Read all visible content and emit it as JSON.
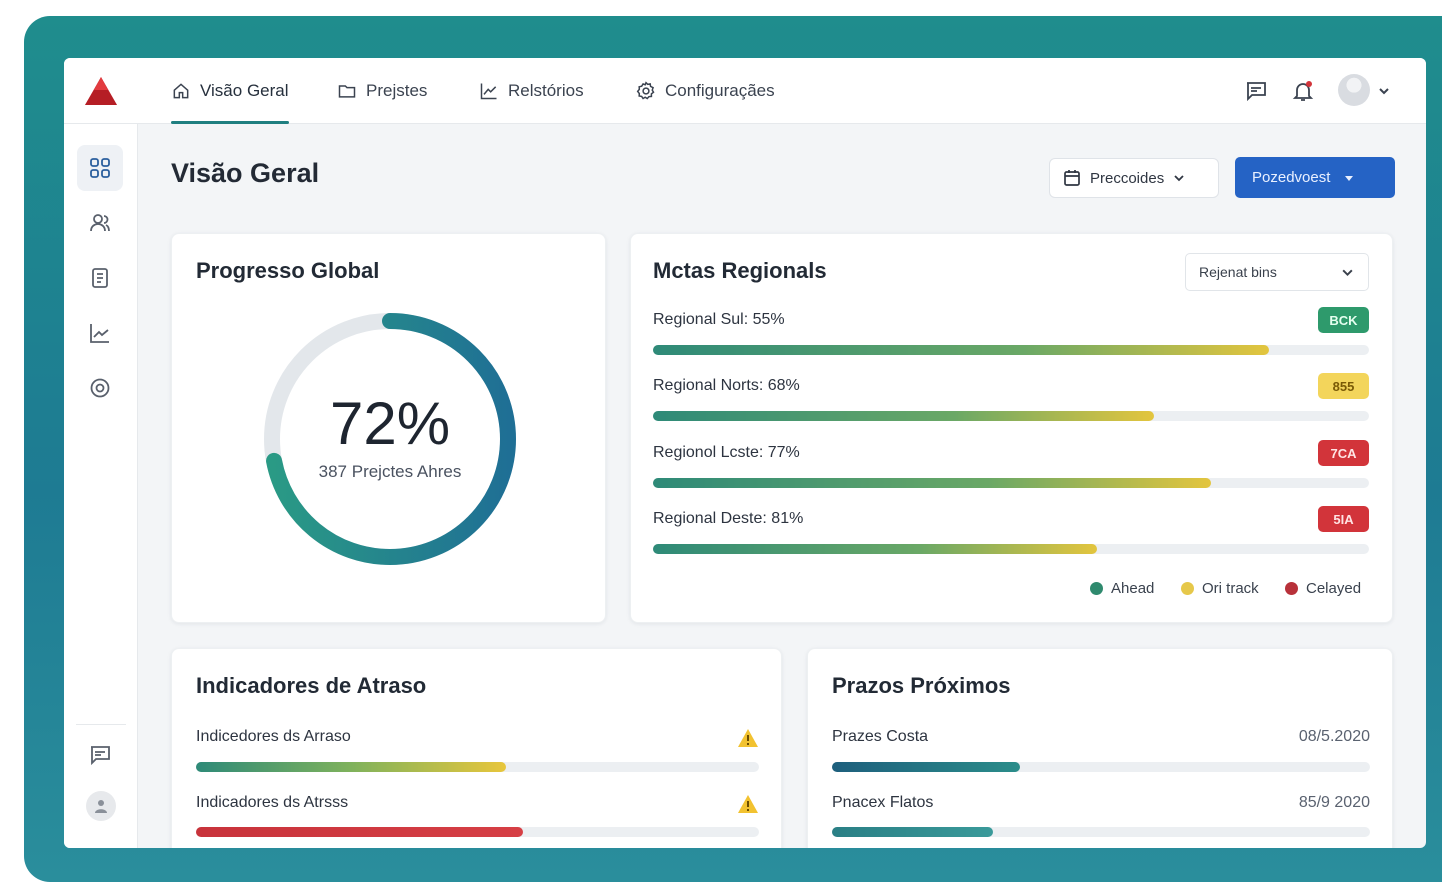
{
  "nav": {
    "tabs": [
      {
        "label": "Visão Geral",
        "icon": "home-icon",
        "active": true
      },
      {
        "label": "Prejstes",
        "icon": "folder-icon"
      },
      {
        "label": "Relstórios",
        "icon": "chart-icon"
      },
      {
        "label": "Configuraçães",
        "icon": "settings-gear-icon"
      }
    ]
  },
  "header": {
    "title": "Visão Geral",
    "period_button": "Preccoides",
    "primary_button": "Pozedvoest"
  },
  "progress_card": {
    "title": "Progresso Global",
    "value_label": "72%",
    "progress": 0.72,
    "subtitle": "387 Prejctes Ahres"
  },
  "regional_card": {
    "title": "Mctas Regionals",
    "select_value": "Rejenat bins",
    "rows": [
      {
        "label": "Regional Sul: 55%",
        "progress": 0.86,
        "badge": "BCK",
        "badge_color": "#2e9a6c",
        "badge_text_color": "#e6fff0"
      },
      {
        "label": "Regional Norts: 68%",
        "progress": 0.7,
        "badge": "855",
        "badge_color": "#f3d55b",
        "badge_text_color": "#7a5a06"
      },
      {
        "label": "Regionol Lcste: 77%",
        "progress": 0.78,
        "badge": "7CA",
        "badge_color": "#d2343a",
        "badge_text_color": "#ffe4e4"
      },
      {
        "label": "Regional Deste: 81%",
        "progress": 0.62,
        "badge": "5IA",
        "badge_color": "#d2343a",
        "badge_text_color": "#ffe4e4"
      }
    ],
    "legend": [
      {
        "label": "Ahead",
        "color": "#2f8a6e"
      },
      {
        "label": "Ori track",
        "color": "#e6c84a"
      },
      {
        "label": "Celayed",
        "color": "#b8313a"
      }
    ]
  },
  "delay_card": {
    "title": "Indicadores de Atraso",
    "rows": [
      {
        "label": "Indicedores ds Arraso",
        "progress": 0.55
      },
      {
        "label": "Indicadores ds Atrsss",
        "progress": 0.58
      }
    ]
  },
  "deadlines_card": {
    "title": "Prazos Próximos",
    "rows": [
      {
        "label": "Prazes Costa",
        "date": "08/5.2020",
        "progress": 0.35
      },
      {
        "label": "Pnacex Flatos",
        "date": "85/9 2020",
        "progress": 0.3
      }
    ]
  },
  "colors": {
    "accent": "#1f7f80",
    "primary_button": "#2563c5",
    "frame": "#1e7f90"
  }
}
